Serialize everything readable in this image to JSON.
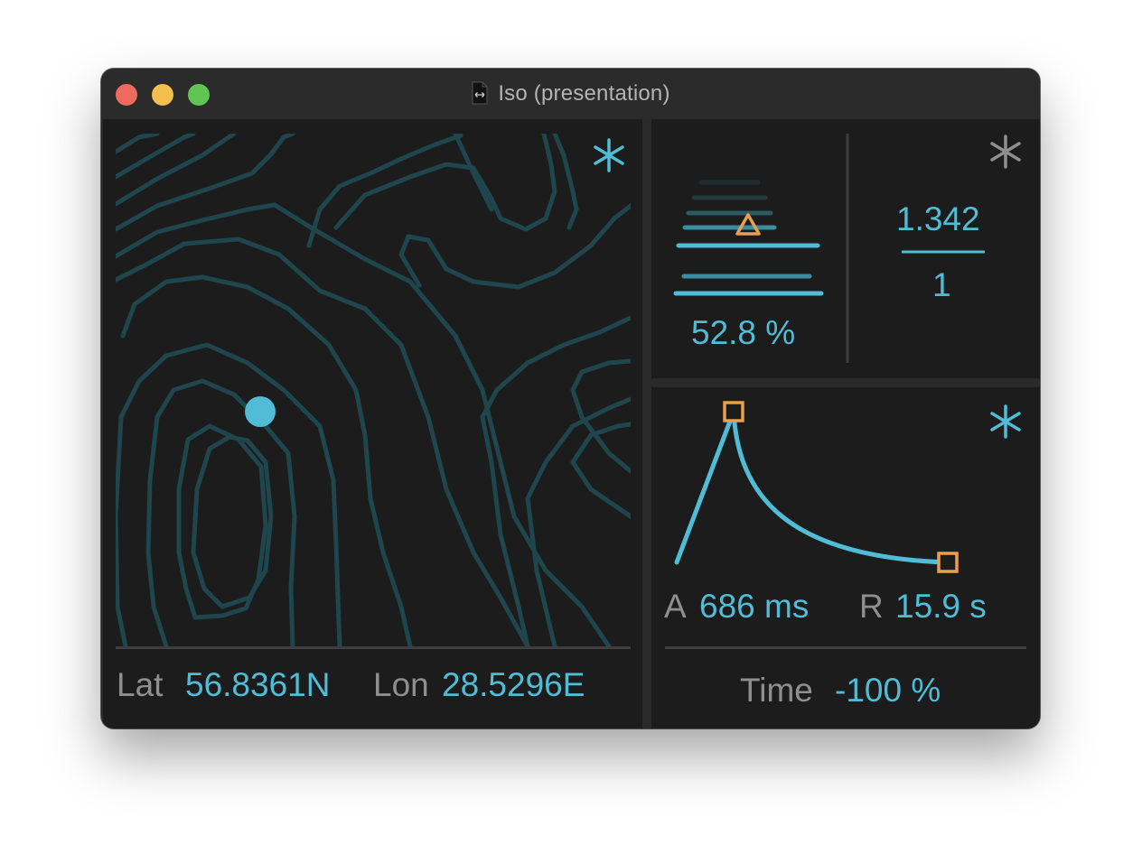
{
  "window": {
    "title": "Iso (presentation)"
  },
  "colors": {
    "accent": "#50bcd6",
    "marker": "#e8a050",
    "label": "#8f8f8f",
    "contour": "#1f454d",
    "panel": "#1c1c1c"
  },
  "map": {
    "icon": "asterisk-icon",
    "lat_label": "Lat",
    "lat_value": "56.8361N",
    "lon_label": "Lon",
    "lon_value": "28.5296E"
  },
  "level": {
    "value": "52.8 %",
    "level": 0.528,
    "icon": "asterisk-icon"
  },
  "ratio": {
    "numerator": "1.342",
    "denominator": "1"
  },
  "envelope": {
    "icon": "asterisk-icon",
    "attack_label": "A",
    "attack_value": "686 ms",
    "release_label": "R",
    "release_value": "15.9 s",
    "time_label": "Time",
    "time_value": "-100 %"
  }
}
